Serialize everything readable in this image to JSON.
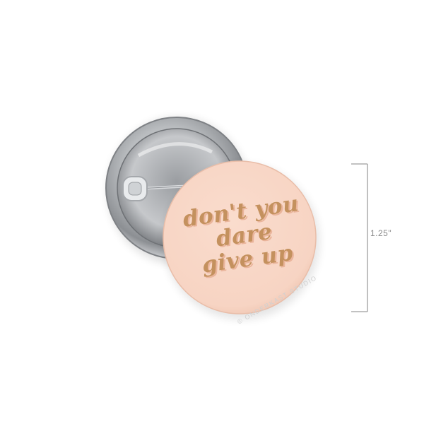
{
  "product": {
    "slogan_lines": [
      "don't you",
      "dare",
      "give up"
    ],
    "size_label": "1.25\"",
    "watermark": "© ONDERKAST STUDIO"
  },
  "colors": {
    "badge_face": "#f8d7c8",
    "text": "#c4915e",
    "text_shadow": "#eab59c",
    "metal_back": "#c7c9cc",
    "measure_line": "#9e9e9e"
  }
}
